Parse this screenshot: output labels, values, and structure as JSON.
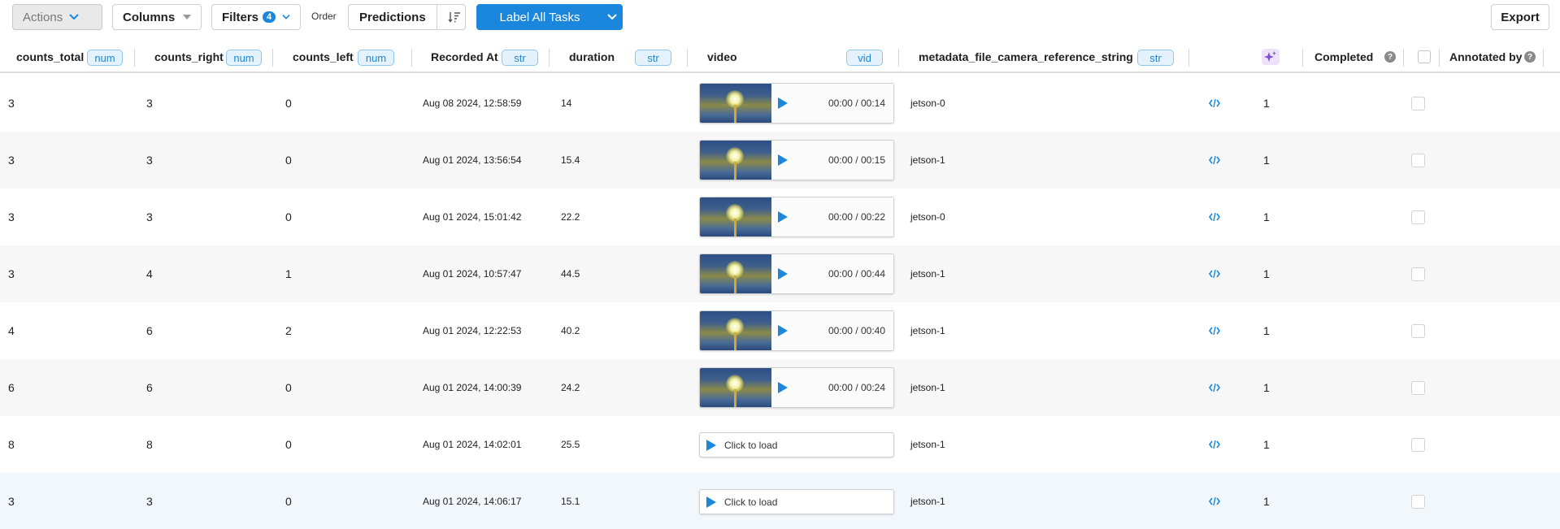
{
  "toolbar": {
    "actions_label": "Actions",
    "columns_label": "Columns",
    "filters_label": "Filters",
    "filters_count": "4",
    "order_label": "Order",
    "predictions_label": "Predictions",
    "label_all_label": "Label All Tasks",
    "export_label": "Export"
  },
  "columns": {
    "counts_total": {
      "label": "counts_total",
      "type": "num"
    },
    "counts_right": {
      "label": "counts_right",
      "type": "num"
    },
    "counts_left": {
      "label": "counts_left",
      "type": "num"
    },
    "recorded_at": {
      "label": "Recorded At",
      "type": "str"
    },
    "duration": {
      "label": "duration",
      "type": "str"
    },
    "video": {
      "label": "video",
      "type": "vid"
    },
    "camera": {
      "label": "metadata_file_camera_reference_string",
      "type": "str"
    },
    "completed": {
      "label": "Completed",
      "help": "?"
    },
    "annotated_by": {
      "label": "Annotated by",
      "help": "?"
    }
  },
  "rows": [
    {
      "counts_total": "3",
      "counts_right": "3",
      "counts_left": "0",
      "recorded_at": "Aug 08 2024, 12:58:59",
      "duration": "14",
      "video_time": "00:00 / 00:14",
      "camera": "jetson-0",
      "annotations": "1",
      "loaded": true
    },
    {
      "counts_total": "3",
      "counts_right": "3",
      "counts_left": "0",
      "recorded_at": "Aug 01 2024, 13:56:54",
      "duration": "15.4",
      "video_time": "00:00 / 00:15",
      "camera": "jetson-1",
      "annotations": "1",
      "loaded": true
    },
    {
      "counts_total": "3",
      "counts_right": "3",
      "counts_left": "0",
      "recorded_at": "Aug 01 2024, 15:01:42",
      "duration": "22.2",
      "video_time": "00:00 / 00:22",
      "camera": "jetson-0",
      "annotations": "1",
      "loaded": true
    },
    {
      "counts_total": "3",
      "counts_right": "4",
      "counts_left": "1",
      "recorded_at": "Aug 01 2024, 10:57:47",
      "duration": "44.5",
      "video_time": "00:00 / 00:44",
      "camera": "jetson-1",
      "annotations": "1",
      "loaded": true
    },
    {
      "counts_total": "4",
      "counts_right": "6",
      "counts_left": "2",
      "recorded_at": "Aug 01 2024, 12:22:53",
      "duration": "40.2",
      "video_time": "00:00 / 00:40",
      "camera": "jetson-1",
      "annotations": "1",
      "loaded": true
    },
    {
      "counts_total": "6",
      "counts_right": "6",
      "counts_left": "0",
      "recorded_at": "Aug 01 2024, 14:00:39",
      "duration": "24.2",
      "video_time": "00:00 / 00:24",
      "camera": "jetson-1",
      "annotations": "1",
      "loaded": true
    },
    {
      "counts_total": "8",
      "counts_right": "8",
      "counts_left": "0",
      "recorded_at": "Aug 01 2024, 14:02:01",
      "duration": "25.5",
      "video_time": "Click to load",
      "camera": "jetson-1",
      "annotations": "1",
      "loaded": false
    },
    {
      "counts_total": "3",
      "counts_right": "3",
      "counts_left": "0",
      "recorded_at": "Aug 01 2024, 14:06:17",
      "duration": "15.1",
      "video_time": "Click to load",
      "camera": "jetson-1",
      "annotations": "1",
      "loaded": false
    }
  ],
  "colors": {
    "accent": "#1a87dd",
    "tag_bg": "#e3f2fc",
    "row_alt": "#f7f7f7",
    "row_highlight": "#f2f7fc"
  }
}
